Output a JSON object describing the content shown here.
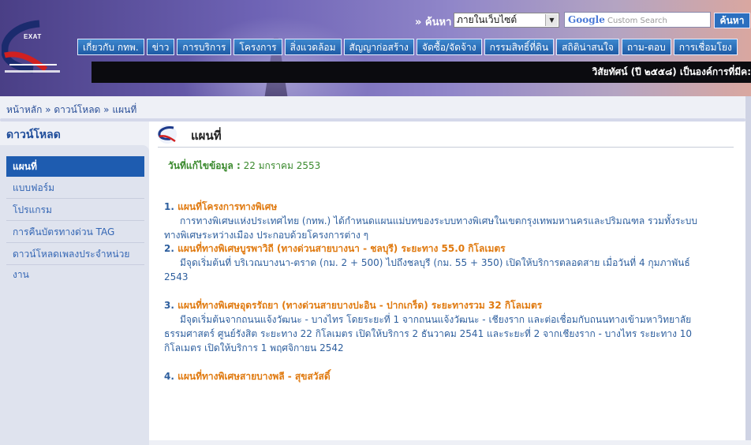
{
  "header": {
    "logo_text": "EXAT",
    "search_label": "» ค้นหา",
    "search_scope": "ภายในเว็บไซต์",
    "search_placeholder_brand": "Google",
    "search_placeholder": "Custom Search",
    "search_button": "ค้นหา",
    "nav": [
      "เกี่ยวกับ กทพ.",
      "ข่าว",
      "การบริการ",
      "โครงการ",
      "สิ่งแวดล้อม",
      "สัญญาก่อสร้าง",
      "จัดซื้อ/จัดจ้าง",
      "กรรมสิทธิ์ที่ดิน",
      "สถิติน่าสนใจ",
      "ถาม-ตอบ",
      "การเชื่อมโยง"
    ],
    "marquee": "วิสัยทัศน์ (ปี ๒๕๕๘) เป็นองค์การที่มีค:"
  },
  "breadcrumb": {
    "home": "หน้าหลัก",
    "sep": " » ",
    "download": "ดาวน์โหลด",
    "current": "แผนที่"
  },
  "sidebar": {
    "title": "ดาวน์โหลด",
    "items": [
      {
        "label": "แผนที่"
      },
      {
        "label": "แบบฟอร์ม"
      },
      {
        "label": "โปรแกรม"
      },
      {
        "label": "การคืนบัตรทางด่วน TAG"
      },
      {
        "label": "ดาวน์โหลดเพลงประจำหน่วยงาน"
      }
    ]
  },
  "main": {
    "title": "แผนที่",
    "updated_label": "วันที่แก้ไขข้อมูล :",
    "updated_value": " 22 มกราคม 2553",
    "sections": [
      {
        "num": "1. ",
        "heading": "แผนที่โครงการทางพิเศษ",
        "body": "การทางพิเศษแห่งประเทศไทย (กทพ.) ได้กำหนดแผนแม่บทของระบบทางพิเศษในเขตกรุงเทพมหานครและปริมณฑล รวมทั้งระบบทางพิเศษระหว่างเมือง ประกอบด้วยโครงการต่าง ๆ"
      },
      {
        "num": "2. ",
        "heading": "แผนที่ทางพิเศษบูรพาวิถี (ทางด่วนสายบางนา - ชลบุรี) ระยะทาง 55.0 กิโลเมตร",
        "body": "มีจุดเริ่มต้นที่ บริเวณบางนา-ตราด (กม. 2 + 500) ไปถึงชลบุรี (กม. 55 + 350) เปิดให้บริการตลอดสาย เมื่อวันที่ 4 กุมภาพันธ์ 2543"
      },
      {
        "num": "3. ",
        "heading": "แผนที่ทางพิเศษอุดรรัถยา (ทางด่วนสายบางปะอิน - ปากเกร็ด) ระยะทางรวม 32 กิโลเมตร",
        "body": "มีจุดเริ่มต้นจากถนนแจ้งวัฒนะ - บางไทร โดยระยะที่ 1 จากถนนแจ้งวัฒนะ - เชียงราก และต่อเชื่อมกับถนนทางเข้ามหาวิทยาลัยธรรมศาสตร์ ศูนย์รังสิต ระยะทาง 22 กิโลเมตร เปิดให้บริการ 2 ธันวาคม 2541 และระยะที่ 2 จากเชียงราก - บางไทร ระยะทาง 10 กิโลเมตร เปิดให้บริการ 1 พฤศจิกายน 2542"
      },
      {
        "num": "4. ",
        "heading": "แผนที่ทางพิเศษสายบางพลี - สุขสวัสดิ์",
        "body": ""
      }
    ]
  }
}
